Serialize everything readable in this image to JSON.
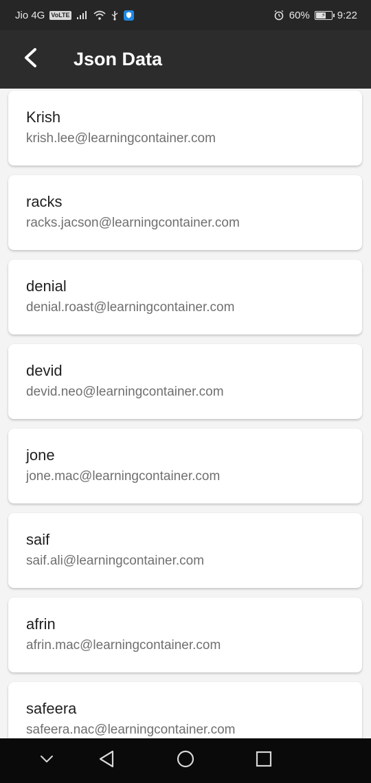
{
  "status_bar": {
    "carrier": "Jio 4G",
    "volte": "VoLTE",
    "battery_percent": "60%",
    "time": "9:22"
  },
  "app_bar": {
    "title": "Json Data"
  },
  "contacts": [
    {
      "name": "Krish",
      "email": "krish.lee@learningcontainer.com"
    },
    {
      "name": "racks",
      "email": "racks.jacson@learningcontainer.com"
    },
    {
      "name": "denial",
      "email": "denial.roast@learningcontainer.com"
    },
    {
      "name": "devid",
      "email": "devid.neo@learningcontainer.com"
    },
    {
      "name": "jone",
      "email": "jone.mac@learningcontainer.com"
    },
    {
      "name": "saif",
      "email": "saif.ali@learningcontainer.com"
    },
    {
      "name": "afrin",
      "email": "afrin.mac@learningcontainer.com"
    },
    {
      "name": "safeera",
      "email": "safeera.nac@learningcontainer.com"
    }
  ],
  "icons": {
    "back": "back-arrow-icon",
    "nav_collapse": "chevron-down-icon",
    "nav_back": "triangle-back-icon",
    "nav_home": "circle-home-icon",
    "nav_recents": "square-recents-icon"
  }
}
